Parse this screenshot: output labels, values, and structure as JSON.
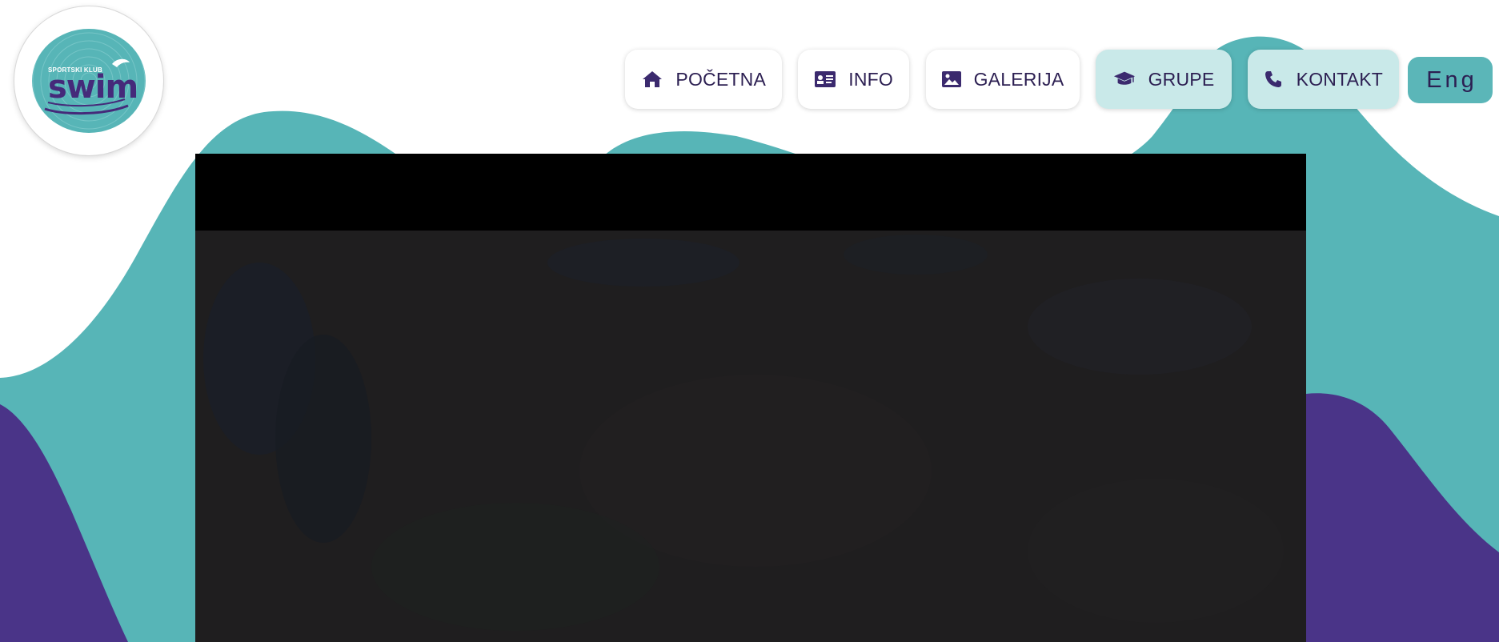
{
  "logo": {
    "subtitle": "SPORTSKI KLUB",
    "name": "swim"
  },
  "nav": {
    "items": [
      {
        "label": "POČETNA",
        "icon": "home-icon",
        "active": false
      },
      {
        "label": "INFO",
        "icon": "id-card-icon",
        "active": false
      },
      {
        "label": "GALERIJA",
        "icon": "image-icon",
        "active": false
      },
      {
        "label": "GRUPE",
        "icon": "graduation-cap-icon",
        "active": true
      },
      {
        "label": "KONTAKT",
        "icon": "phone-icon",
        "active": true
      }
    ],
    "language": "Eng"
  },
  "colors": {
    "teal": "#57b5b7",
    "purple": "#4a3488",
    "text": "#2c1f52",
    "active_bg": "#c9e9e9"
  }
}
